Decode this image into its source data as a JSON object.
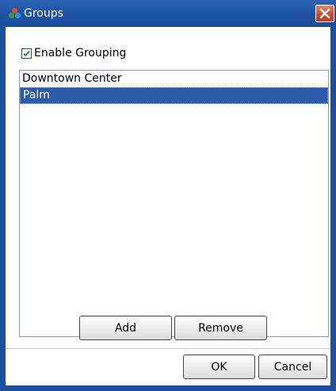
{
  "window": {
    "title": "Groups"
  },
  "options": {
    "enable_grouping_label": "Enable Grouping",
    "enable_grouping_checked": true
  },
  "groups_list": {
    "items": [
      {
        "label": "Downtown Center",
        "selected": false
      },
      {
        "label": "Palm",
        "selected": true
      }
    ]
  },
  "buttons": {
    "add": "Add",
    "remove": "Remove",
    "ok": "OK",
    "cancel": "Cancel"
  },
  "colors": {
    "titlebar": "#1f55a6",
    "selection": "#2c59a8",
    "close_button": "#cf4a2a"
  },
  "icons": {
    "app": "groups-icon",
    "close": "close-icon",
    "checkbox": "checkmark-icon"
  }
}
